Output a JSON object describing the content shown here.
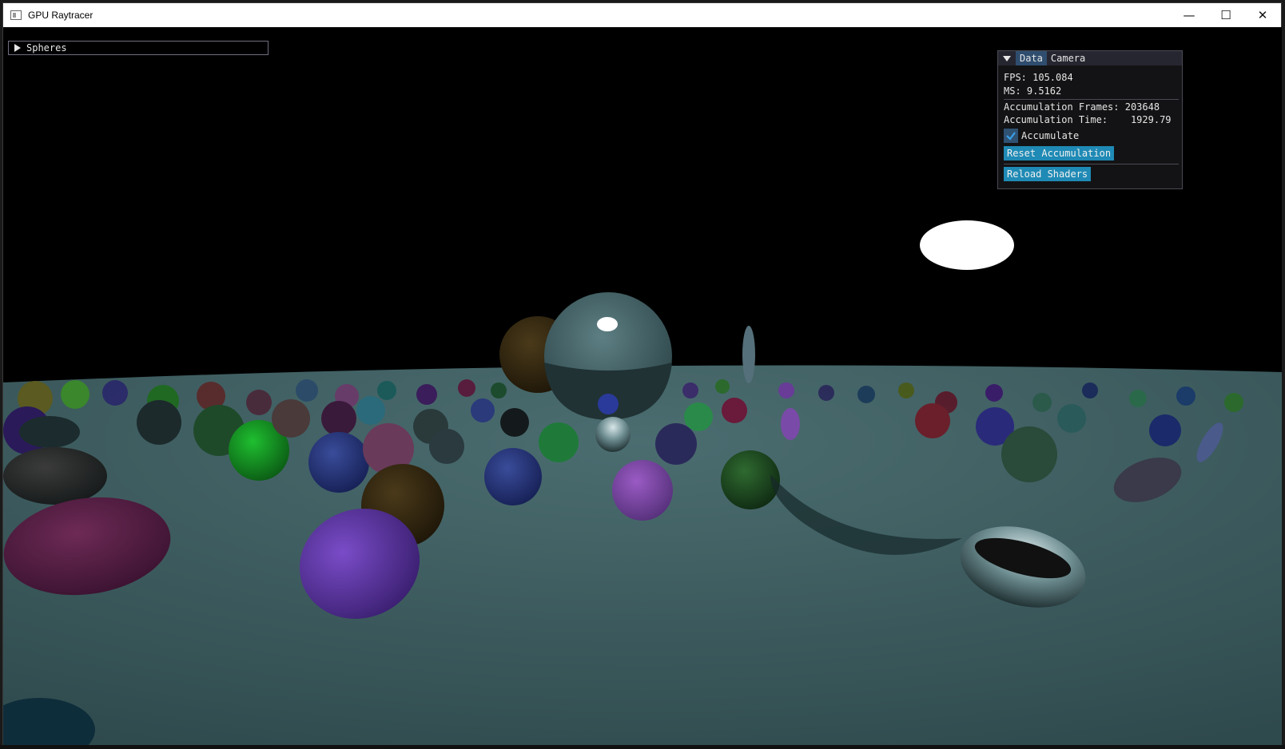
{
  "window": {
    "title": "GPU Raytracer",
    "controls": [
      "—",
      "☐",
      "✕"
    ]
  },
  "spheres_panel": {
    "label": "Spheres"
  },
  "stats_panel": {
    "tabs": [
      "Data",
      "Camera"
    ],
    "active_tab": "Data",
    "fps": "FPS: 105.084",
    "ms": "MS: 9.5162",
    "accumulation_frames": "Accumulation Frames: 203648",
    "accumulation_time": "Accumulation Time:    1929.79",
    "accumulate_label": "Accumulate",
    "accumulate_checked": true,
    "reset_button": "Reset Accumulation",
    "reload_button": "Reload Shaders"
  },
  "colors": {
    "button": "#1f8ab5",
    "active_tab": "#2f4d6e",
    "ground": "#3c5a5e",
    "sky": "#000000"
  }
}
